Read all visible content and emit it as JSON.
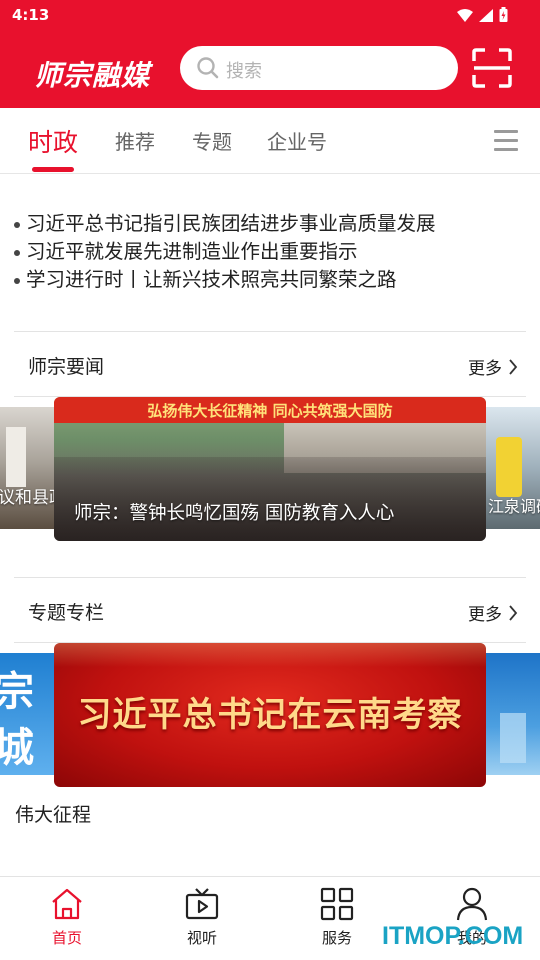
{
  "status_bar": {
    "time": "4:13"
  },
  "header": {
    "logo": "师宗融媒",
    "search_placeholder": "搜索",
    "brand_color": "#e8112d"
  },
  "tabs": [
    {
      "label": "时政",
      "active": true
    },
    {
      "label": "推荐",
      "active": false
    },
    {
      "label": "专题",
      "active": false
    },
    {
      "label": "企业号",
      "active": false
    }
  ],
  "headlines": [
    "习近平总书记指引民族团结进步事业高质量发展",
    "习近平就发展先进制造业作出重要指示",
    "学习进行时丨让新兴技术照亮共同繁荣之路"
  ],
  "news_section": {
    "title": "师宗要闻",
    "more": "更多",
    "left_caption": "议和县政",
    "main_caption": "师宗：警钟长鸣忆国殇  国防教育入人心",
    "right_caption": "江泉调研",
    "banner_text": "弘扬伟大长征精神  同心共筑强大国防"
  },
  "topic_section": {
    "title": "专题专栏",
    "more": "更多",
    "left_text": [
      "宗",
      "城"
    ],
    "banner_text": "习近平总书记在云南考察",
    "caption": "伟大征程"
  },
  "bottom_nav": [
    {
      "label": "首页",
      "icon": "home-icon",
      "active": true
    },
    {
      "label": "视听",
      "icon": "video-icon",
      "active": false
    },
    {
      "label": "服务",
      "icon": "grid-icon",
      "active": false
    },
    {
      "label": "我的",
      "icon": "user-icon",
      "active": false
    }
  ],
  "watermark": "ITMOP.COM"
}
